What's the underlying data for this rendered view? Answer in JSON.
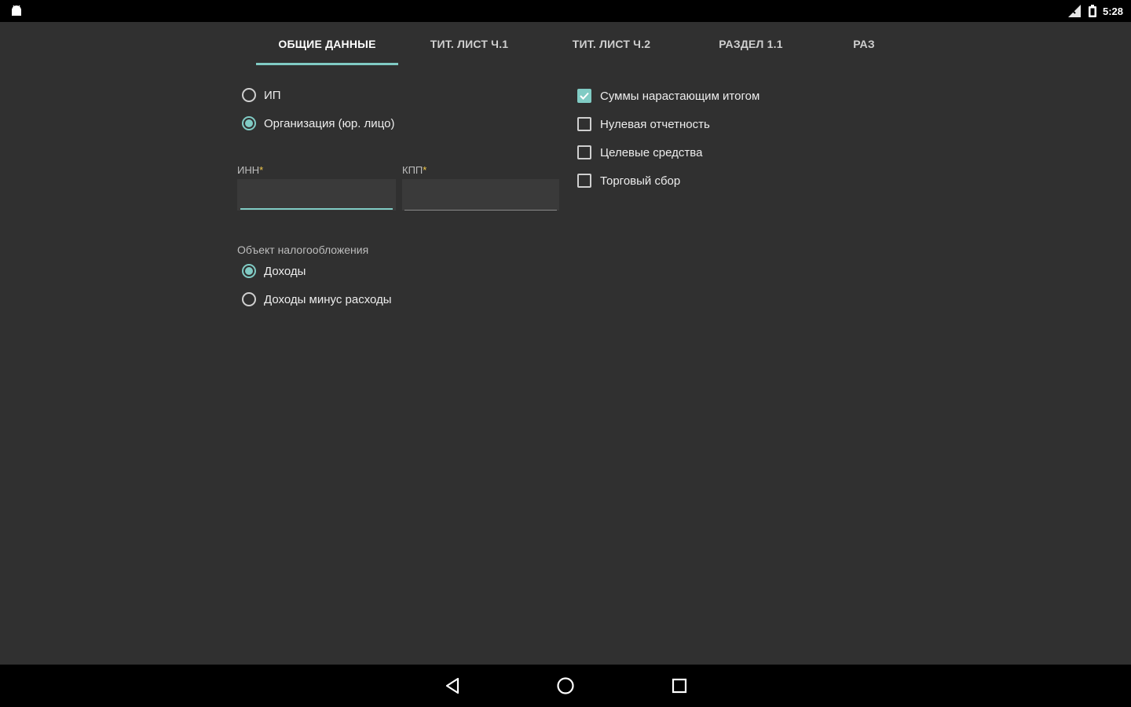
{
  "status_bar": {
    "time": "5:28",
    "notification_icon": "android-icon",
    "signal_icon": "signal-icon",
    "battery_icon": "battery-icon"
  },
  "tabs": [
    {
      "label": "ОБЩИЕ ДАННЫЕ",
      "active": true
    },
    {
      "label": "ТИТ. ЛИСТ Ч.1",
      "active": false
    },
    {
      "label": "ТИТ. ЛИСТ Ч.2",
      "active": false
    },
    {
      "label": "РАЗДЕЛ 1.1",
      "active": false
    },
    {
      "label": "РАЗ",
      "active": false
    }
  ],
  "entity_type": {
    "options": [
      {
        "label": "ИП",
        "checked": false
      },
      {
        "label": "Организация (юр. лицо)",
        "checked": true
      }
    ]
  },
  "fields": {
    "inn": {
      "label": "ИНН",
      "required_mark": "*",
      "value": ""
    },
    "kpp": {
      "label": "КПП",
      "required_mark": "*",
      "value": ""
    }
  },
  "tax_object": {
    "label": "Объект налогообложения",
    "options": [
      {
        "label": "Доходы",
        "checked": true
      },
      {
        "label": "Доходы минус расходы",
        "checked": false
      }
    ]
  },
  "options": [
    {
      "label": "Суммы нарастающим итогом",
      "checked": true
    },
    {
      "label": "Нулевая отчетность",
      "checked": false
    },
    {
      "label": "Целевые средства",
      "checked": false
    },
    {
      "label": "Торговый сбор",
      "checked": false
    }
  ],
  "colors": {
    "accent": "#80cbc4",
    "background": "#303030",
    "required": "#f2c94c"
  },
  "nav_bar": {
    "back_icon": "back-icon",
    "home_icon": "home-icon",
    "recents_icon": "recents-icon"
  }
}
